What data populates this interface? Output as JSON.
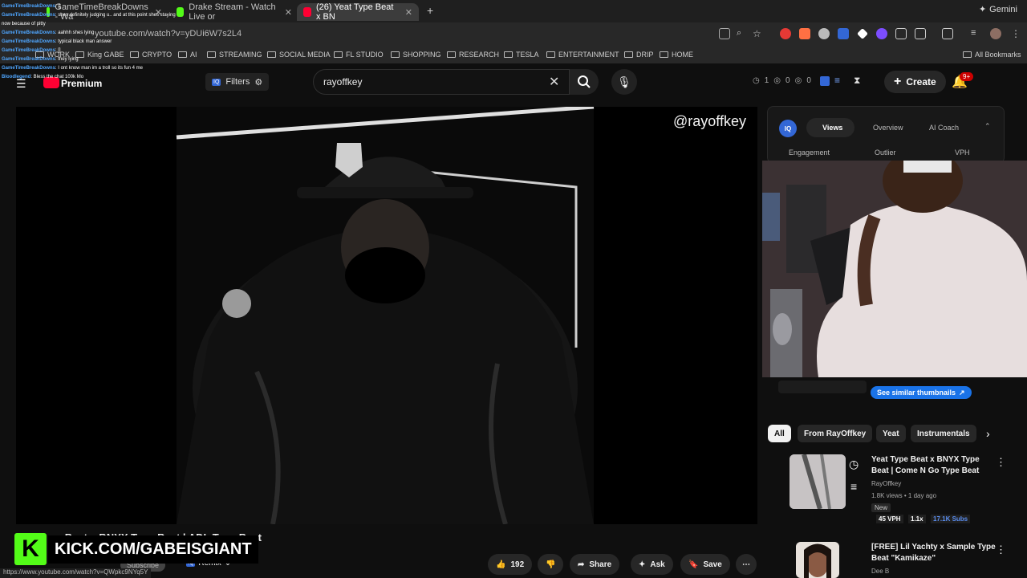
{
  "browser": {
    "tabs": [
      {
        "label": "GameTimeBreakDowns - Wa",
        "favicon_color": "#53fc18"
      },
      {
        "label": "Drake Stream - Watch Live or",
        "favicon_color": "#53fc18"
      },
      {
        "label": "(26) Yeat Type Beat x BN",
        "favicon_color": "#ff0033",
        "active": true
      }
    ],
    "new_tab_label": "+",
    "gemini_label": "Gemini",
    "url": "youtube.com/watch?v=yDUi6W7s2L4",
    "bookmarks": [
      "WORK",
      "King GABE",
      "CRYPTO",
      "AI",
      "STREAMING",
      "SOCIAL MEDIA",
      "FL STUDIO",
      "SHOPPING",
      "RESEARCH",
      "TESLA",
      "ENTERTAINMENT",
      "DRIP",
      "HOME"
    ],
    "all_bookmarks": "All Bookmarks",
    "status_url": "https://www.youtube.com/watch?v=QWpkc9NYq5Y"
  },
  "youtube": {
    "logo_label": "Premium",
    "filters_label": "Filters",
    "search_value": "rayoffkey",
    "stats": [
      "1",
      "0",
      "0"
    ],
    "create_label": "Create",
    "notif_badge": "9+"
  },
  "video": {
    "channel_handle": "@rayoffkey",
    "partial_title": "ne Beat x BNYX Type Beat | ADL Type Beat",
    "subscribe_label": "Subscribe",
    "remix_label": "Remix",
    "likes": "192",
    "share_label": "Share",
    "ask_label": "Ask",
    "save_label": "Save"
  },
  "vidiq": {
    "tabs": [
      "Views",
      "Overview",
      "AI Coach"
    ],
    "subtabs": [
      "Engagement",
      "Outlier",
      "VPH"
    ],
    "similar_label": "See similar thumbnails"
  },
  "chips": [
    "All",
    "From RayOffkey",
    "Yeat",
    "Instrumentals"
  ],
  "recommendations": [
    {
      "title_line1": "Yeat Type Beat x BNYX Type",
      "title_line2": "Beat | Come N Go Type Beat",
      "channel": "RayOffkey",
      "meta": "1.8K views • 1 day ago",
      "badge": "New",
      "vph": "45 VPH",
      "mult": "1.1x",
      "subs": "17.1K Subs"
    },
    {
      "title_line1": "[FREE] Lil Yachty x Sample Type",
      "title_line2": "Beat \"Kamikaze\"",
      "channel": "Dee B"
    }
  ],
  "kick": {
    "logo_letter": "K",
    "text": "KICK.COM/GABEISGIANT"
  },
  "chat": [
    {
      "user": "GameTimeBreakDowns",
      "msg": ": []"
    },
    {
      "user": "GameTimeBreakDowns",
      "msg": ": shes definitely judging u.. and at this point shes staying now because of pitty"
    },
    {
      "user": "GameTimeBreakDowns",
      "msg": ": aahhh shes lying"
    },
    {
      "user": "GameTimeBreakDowns",
      "msg": ": typical black man answer"
    },
    {
      "user": "GameTimeBreakDowns",
      "msg": ": []"
    },
    {
      "user": "GameTimeBreakDowns",
      "msg": ": they lying"
    },
    {
      "user": "GameTimeBreakDowns",
      "msg": ": I ont know man im a troll so its fun 4 me"
    },
    {
      "user": "Bloodlegend",
      "msg": ": Bless the chat 100k Mo"
    }
  ]
}
